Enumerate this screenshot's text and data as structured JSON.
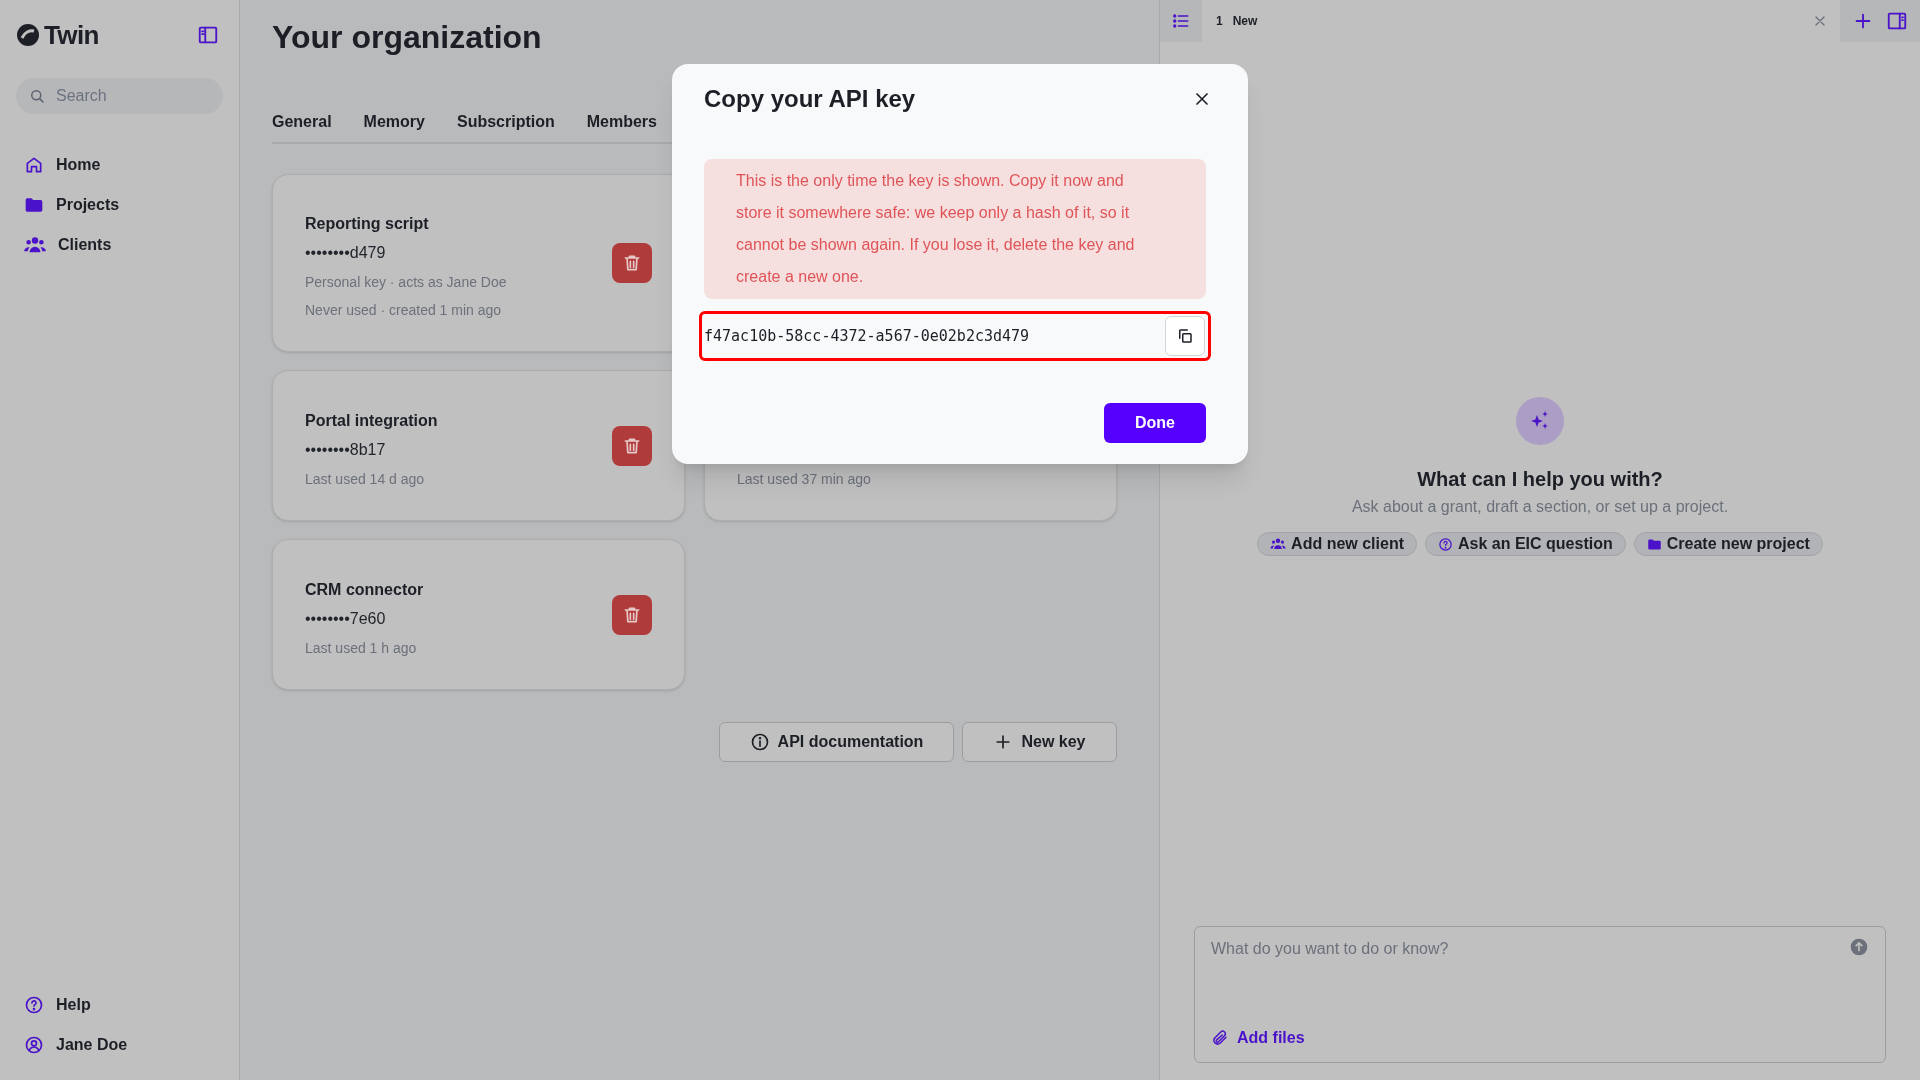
{
  "sidebar": {
    "logo": "Twin",
    "search": {
      "placeholder": "Search"
    },
    "nav": [
      {
        "label": "Home"
      },
      {
        "label": "Projects"
      },
      {
        "label": "Clients"
      }
    ],
    "footer": [
      {
        "label": "Help"
      },
      {
        "label": "Jane Doe"
      }
    ]
  },
  "main": {
    "title": "Your organization",
    "tabs": [
      {
        "label": "General",
        "selected": false
      },
      {
        "label": "Memory",
        "selected": false
      },
      {
        "label": "Subscription",
        "selected": false
      },
      {
        "label": "Members",
        "selected": false
      }
    ],
    "keys": [
      {
        "name": "Reporting script",
        "key": "••••••••d479",
        "meta": [
          "Personal key · acts as Jane Doe",
          "Never used · created 1 min ago"
        ]
      },
      {
        "name": "Portal integration",
        "key": "••••••••8b17",
        "meta": [
          "Last used 14 d ago"
        ]
      },
      {
        "meta": [
          "Last used 37 min ago"
        ]
      },
      {
        "name": "CRM connector",
        "key": "••••••••7e60",
        "meta": [
          "Last used 1 h ago"
        ]
      }
    ],
    "buttons": [
      "API documentation",
      "New key"
    ]
  },
  "dialog": {
    "title": "Copy your API key",
    "warning": "This is the only time the key is shown. Copy it now and store it somewhere safe: we keep only a hash of it, so it cannot be shown again. If you lose it, delete the key and create a new one.",
    "key": "f47ac10b-58cc-4372-a567-0e02b2c3d479",
    "button": "Done"
  },
  "assistant": {
    "tab": {
      "number": "1",
      "label": "New"
    },
    "heading": "What can I help you with?",
    "subtitle": "Ask about a grant, draft a section, or set up a project.",
    "suggestions": [
      "Add new client",
      "Ask an EIC question",
      "Create new project"
    ],
    "composer": {
      "placeholder": "What do you want to do or know?",
      "attach": "Add files"
    }
  }
}
